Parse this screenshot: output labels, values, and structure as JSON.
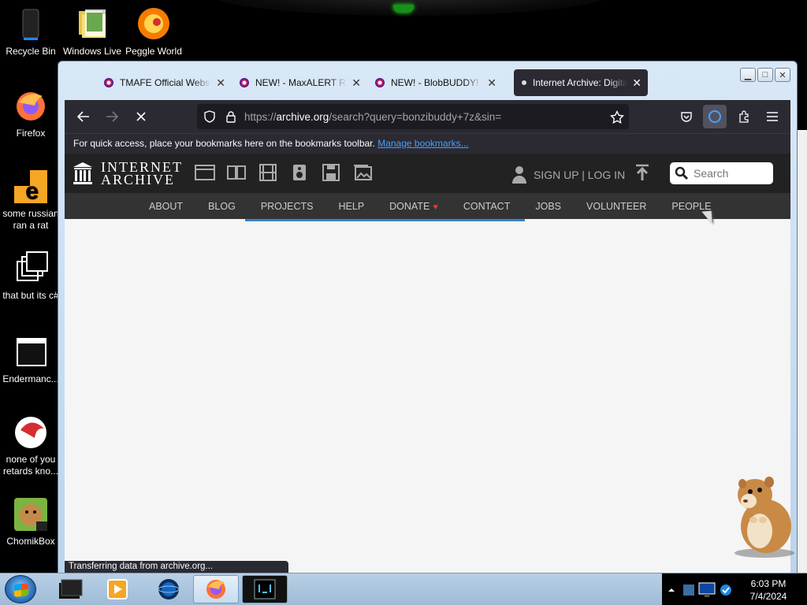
{
  "desktop": {
    "icons": [
      {
        "label": "Recycle Bin"
      },
      {
        "label": "Windows Live"
      },
      {
        "label": "Peggle World"
      },
      {
        "label": "Firefox"
      },
      {
        "label": "some russian ran a rat"
      },
      {
        "label": "that but its c#"
      },
      {
        "label": "Endermanc..."
      },
      {
        "label": "none of you retards kno..."
      },
      {
        "label": "ChomikBox"
      }
    ]
  },
  "browser": {
    "tabs": [
      {
        "title": "TMAFE Official Website"
      },
      {
        "title": "NEW! - MaxALERT Re"
      },
      {
        "title": "NEW! - BlobBUDDY!"
      },
      {
        "title": "Internet Archive: Digital Library"
      }
    ],
    "url": {
      "prefix": "https://",
      "domain": "archive.org",
      "path": "/search?query=bonzibuddy+7z&sin="
    },
    "bookmarks_bar": {
      "text": "For quick access, place your bookmarks here on the bookmarks toolbar.",
      "link": "Manage bookmarks..."
    },
    "status": "Transferring data from archive.org..."
  },
  "archive": {
    "logo_line1": "INTERNET",
    "logo_line2": "ARCHIVE",
    "auth": "SIGN UP | LOG IN",
    "search_placeholder": "Search",
    "nav": [
      "ABOUT",
      "BLOG",
      "PROJECTS",
      "HELP",
      "DONATE",
      "CONTACT",
      "JOBS",
      "VOLUNTEER",
      "PEOPLE"
    ]
  },
  "taskbar": {
    "time": "6:03 PM",
    "date": "7/4/2024"
  },
  "colors": {
    "toolbar": "#2b2a33",
    "ia_header": "#222222",
    "ia_nav": "#333333",
    "progress": "#3b82c4",
    "link": "#45a1ff"
  }
}
